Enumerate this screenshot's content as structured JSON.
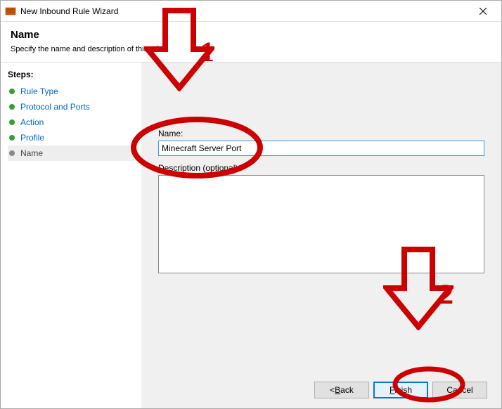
{
  "window": {
    "title": "New Inbound Rule Wizard"
  },
  "header": {
    "heading": "Name",
    "subtext": "Specify the name and description of this rule."
  },
  "sidebar": {
    "steps_label": "Steps:",
    "items": [
      {
        "label": "Rule Type"
      },
      {
        "label": "Protocol and Ports"
      },
      {
        "label": "Action"
      },
      {
        "label": "Profile"
      },
      {
        "label": "Name"
      }
    ]
  },
  "form": {
    "name_label": "Name:",
    "name_value": "Minecraft Server Port",
    "desc_label": "Description (optional):",
    "desc_value": ""
  },
  "buttons": {
    "back": "< Back",
    "back_key": "B",
    "finish": "Finish",
    "finish_key": "F",
    "cancel": "Cancel"
  },
  "annotations": {
    "num1": "1",
    "num2": "2"
  }
}
